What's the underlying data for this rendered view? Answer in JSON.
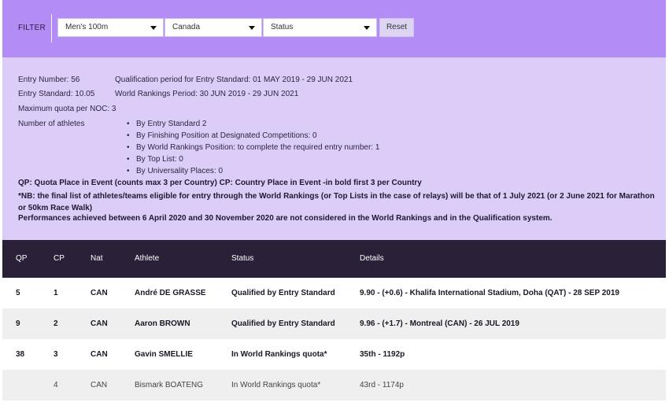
{
  "filter": {
    "label": "FILTER",
    "event": "Men's 100m",
    "country": "Canada",
    "status": "Status",
    "reset_label": "Reset"
  },
  "info": {
    "entry_number": "Entry Number: 56",
    "qualification_period": "Qualification period for Entry Standard: 01 MAY 2019 - 29 JUN 2021",
    "entry_standard": "Entry Standard: 10.05",
    "world_rankings_period": "World Rankings Period: 30 JUN 2019 - 29 JUN 2021",
    "max_quota": "Maximum quota per NOC: 3",
    "number_of_athletes": "Number of athletes",
    "breakdown": [
      "By Entry Standard 2",
      "By Finishing Position at Designated Competitions: 0",
      "By World Rankings Position: to complete the required entry number: 1",
      "By Top List: 0",
      "By Universality Places: 0"
    ],
    "legend": "QP: Quota Place in Event (counts max 3 per Country) CP: Country Place in Event -in bold first 3 per Country",
    "nb": "*NB: the final list of athletes/teams eligible for entry through the World Rankings (or Top Lists in the case of relays) will be that of 1 July 2021 (or 2 June 2021 for Marathon or 50km Race Walk)",
    "performances_note": "Performances achieved between 6 April 2020 and 30 November 2020 are not considered in the World Rankings and in the Qualification system."
  },
  "table": {
    "headers": {
      "qp": "QP",
      "cp": "CP",
      "nat": "Nat",
      "athlete": "Athlete",
      "status": "Status",
      "details": "Details"
    },
    "rows": [
      {
        "qp": "5",
        "cp": "1",
        "nat": "CAN",
        "athlete": "André DE GRASSE",
        "status": "Qualified by Entry Standard",
        "details": "9.90 - (+0.6) - Khalifa International Stadium, Doha (QAT) - 28 SEP 2019"
      },
      {
        "qp": "9",
        "cp": "2",
        "nat": "CAN",
        "athlete": "Aaron BROWN",
        "status": "Qualified by Entry Standard",
        "details": "9.96 - (+1.7) - Montreal (CAN) - 26 JUL 2019"
      },
      {
        "qp": "38",
        "cp": "3",
        "nat": "CAN",
        "athlete": "Gavin SMELLIE",
        "status": "In World Rankings quota*",
        "details": "35th - 1192p"
      },
      {
        "qp": "",
        "cp": "4",
        "nat": "CAN",
        "athlete": "Bismark BOATENG",
        "status": "In World Rankings quota*",
        "details": "43rd - 1174p"
      }
    ]
  }
}
